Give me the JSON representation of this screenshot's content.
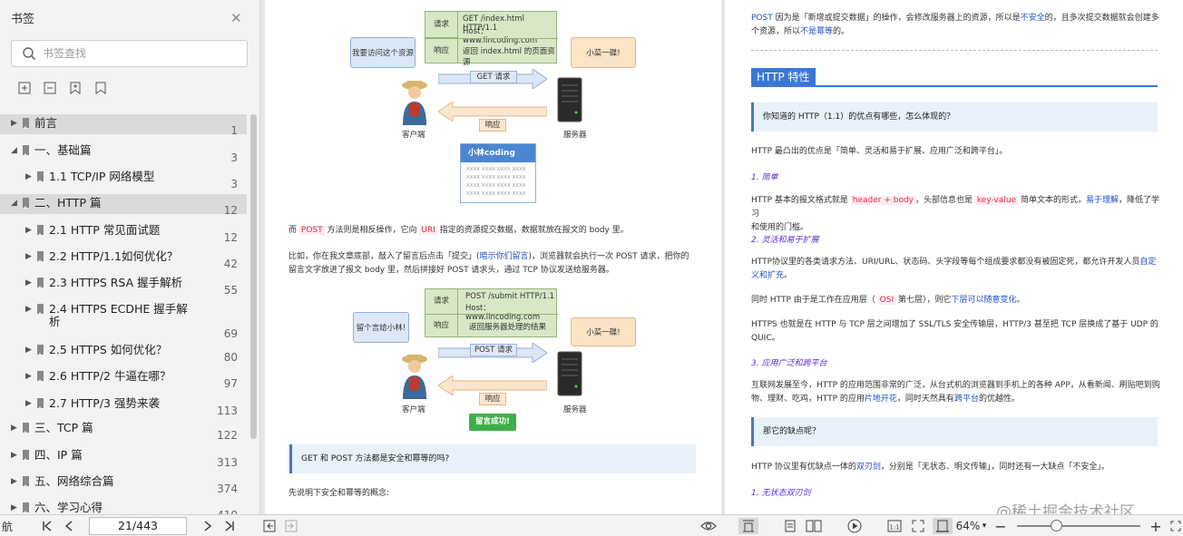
{
  "sidebar": {
    "title": "书签",
    "search_placeholder": "书签查找",
    "items": [
      {
        "label": "前言",
        "page": "1",
        "level": 0,
        "expanded": false
      },
      {
        "label": "一、基础篇",
        "page": "3",
        "level": 0,
        "expanded": true
      },
      {
        "label": "1.1 TCP/IP 网络模型",
        "page": "3",
        "level": 1,
        "expanded": false
      },
      {
        "label": "二、HTTP 篇",
        "page": "12",
        "level": 0,
        "expanded": true
      },
      {
        "label": "2.1 HTTP 常见面试题",
        "page": "12",
        "level": 1,
        "expanded": false
      },
      {
        "label": "2.2 HTTP/1.1如何优化？",
        "page": "42",
        "level": 1,
        "expanded": false
      },
      {
        "label": "2.3 HTTPS RSA 握手解析",
        "page": "55",
        "level": 1,
        "expanded": false
      },
      {
        "label": "2.4 HTTPS ECDHE 握手解",
        "label2": "析",
        "page": "69",
        "level": 1,
        "expanded": false
      },
      {
        "label": "2.5 HTTPS 如何优化？",
        "page": "80",
        "level": 1,
        "expanded": false
      },
      {
        "label": "2.6 HTTP/2 牛逼在哪？",
        "page": "97",
        "level": 1,
        "expanded": false
      },
      {
        "label": "2.7 HTTP/3 强势来袭",
        "page": "113",
        "level": 1,
        "expanded": false
      },
      {
        "label": "三、TCP 篇",
        "page": "122",
        "level": 0,
        "expanded": false
      },
      {
        "label": "四、IP 篇",
        "page": "313",
        "level": 0,
        "expanded": false
      },
      {
        "label": "五、网络综合篇",
        "page": "374",
        "level": 0,
        "expanded": false
      },
      {
        "label": "六、学习心得",
        "page": "410",
        "level": 0,
        "expanded": false
      }
    ]
  },
  "left_page": {
    "diagram1": {
      "req_label": "请求",
      "req_line1": "GET /index.html HTTP/1.1",
      "req_line2": "Host：www.lincoding.com",
      "resp_label": "响应",
      "resp_text": "返回 index.html 的页面资源",
      "client_bubble": "我要访问这个资源",
      "server_bubble": "小菜一碟!",
      "arrow_req": "GET 请求",
      "arrow_resp": "响应",
      "client": "客户端",
      "server": "服务器",
      "card_title": "小林coding",
      "card_line": "XXXX XXXX XXXX XXXX"
    },
    "para1_a": "而",
    "para1_kw1": "POST",
    "para1_b": "方法则是相反操作，它向",
    "para1_kw2": "URI",
    "para1_c": "指定的资源提交数据，数据就放在报文的 body 里。",
    "para2_a": "比如，你在我文章底部，敲入了留言后点击「提交」(",
    "para2_link": "暗示你们留言",
    "para2_b": ")，浏览器就会执行一次 POST 请求，把你的",
    "para2_line2": "留言文字放进了报文 body 里，然后拼接好 POST 请求头，通过 TCP 协议发送给服务器。",
    "diagram2": {
      "req_label": "请求",
      "req_line1": "POST /submit HTTP/1.1",
      "req_line2": "Host：www.lincoding.com",
      "resp_label": "响应",
      "resp_text": "返回服务器处理的结果",
      "client_bubble": "留个言给小林!",
      "server_bubble": "小菜一碟!",
      "arrow_req": "POST 请求",
      "arrow_resp": "响应",
      "client": "客户端",
      "server": "服务器",
      "success": "留言成功!"
    },
    "question": "GET 和 POST 方法都是安全和幂等的吗?",
    "para3": "先说明下安全和幂等的概念:"
  },
  "right_page": {
    "top_kw": "POST",
    "top_a": "因为是「新增或提交数据」的操作，会修改服务器上的资源，所以是",
    "top_kw2": "不安全",
    "top_b": "的，且多次提交数据就会创建多",
    "top_line2_a": "个资源，所以",
    "top_kw3": "不是幂等",
    "top_line2_b": "的。",
    "section_title": "HTTP 特性",
    "q1": "你知道的 HTTP（1.1）的优点有哪些，怎么体现的？",
    "p1": "HTTP 最凸出的优点是「简单、灵活和易于扩展、应用广泛和跨平台」。",
    "h1": "1. 简单",
    "p2_a": "HTTP 基本的报文格式就是",
    "p2_kw1": "header + body",
    "p2_b": "，头部信息也是",
    "p2_kw2": "key-value",
    "p2_c": "简单文本的形式，",
    "p2_kw3": "易于理解",
    "p2_d": "，降低了学习",
    "p2_line2": "和使用的门槛。",
    "h2": "2. 灵活和易于扩展",
    "p3_a": "HTTP协议里的各类请求方法、URI/URL、状态码、头字段等每个组成要求都没有被固定死，都允许开发人员",
    "p3_kw": "自定",
    "p3_line2": "义和扩充",
    "p3_line2_end": "。",
    "p4_a": "同时 HTTP 由于是工作在应用层（",
    "p4_kw1": "OSI",
    "p4_b": "第七层），则它",
    "p4_kw2": "下层可以随意变化",
    "p4_c": "。",
    "p5_line1": "HTTPS 也就是在 HTTP 与 TCP 层之间增加了 SSL/TLS 安全传输层，HTTP/3 甚至把 TCP 层换成了基于 UDP 的",
    "p5_line2": "QUIC。",
    "h3": "3. 应用广泛和跨平台",
    "p6_line1": "互联网发展至今，HTTP 的应用范围非常的广泛，从台式机的浏览器到手机上的各种 APP，从看新闻、刷贴吧到购",
    "p6_a": "物、理财、吃鸡，HTTP 的应用",
    "p6_kw1": "片地开花",
    "p6_b": "，同时天然具有",
    "p6_kw2": "跨平台",
    "p6_c": "的优越性。",
    "q2": "那它的缺点呢？",
    "p7_a": "HTTP 协议里有优缺点一体的",
    "p7_kw": "双刃剑",
    "p7_b": "，分别是「无状态、明文传输」，同时还有一大缺点「不安全」。",
    "h4": "1. 无状态双刃剑"
  },
  "toolbar": {
    "nav_label": "航",
    "page_indicator": "21/443",
    "zoom": "64%"
  },
  "watermark": "@稀土掘金技术社区",
  "colors": {
    "accent": "#3a77d8",
    "keyword_red": "#e0304a",
    "link_blue": "#1e50c8"
  }
}
